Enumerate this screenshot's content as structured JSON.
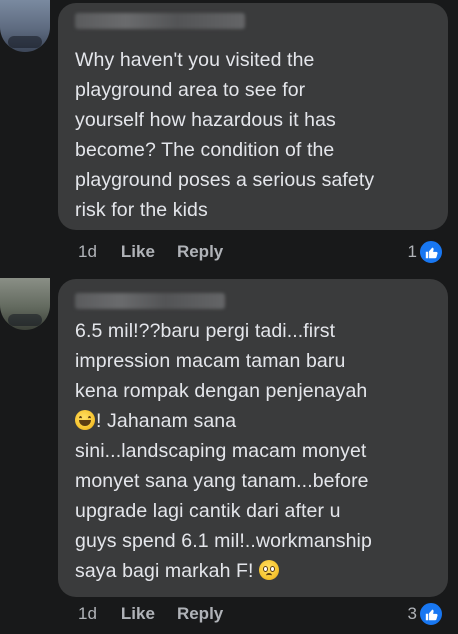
{
  "comments": [
    {
      "text_lines": [
        "Why haven't you visited the",
        "playground area to see for",
        "yourself how hazardous it has",
        "become? The condition of the",
        "playground poses a serious safety",
        "risk for the kids"
      ],
      "time": "1d",
      "like_label": "Like",
      "reply_label": "Reply",
      "reaction_count": "1",
      "reaction_icon": "thumbs-up-icon"
    },
    {
      "text_lines": [
        "6.5 mil!??baru pergi tadi...first",
        "impression macam taman baru",
        "kena rompak dengan penjenayah",
        "! Jahanam sana",
        "sini...landscaping macam monyet",
        "monyet sana yang tanam...before",
        "upgrade lagi cantik dari after u",
        "guys spend 6.1 mil!..workmanship",
        "saya bagi markah F! "
      ],
      "emojis": [
        "grinning-squinting-face-icon",
        "flushed-face-icon"
      ],
      "time": "1d",
      "like_label": "Like",
      "reply_label": "Reply",
      "reaction_count": "3",
      "reaction_icon": "thumbs-up-icon"
    }
  ],
  "colors": {
    "background": "#18191a",
    "bubble": "#3a3b3c",
    "text": "#e4e6eb",
    "secondary_text": "#b0b3b8",
    "like_blue": "#1877f2"
  }
}
